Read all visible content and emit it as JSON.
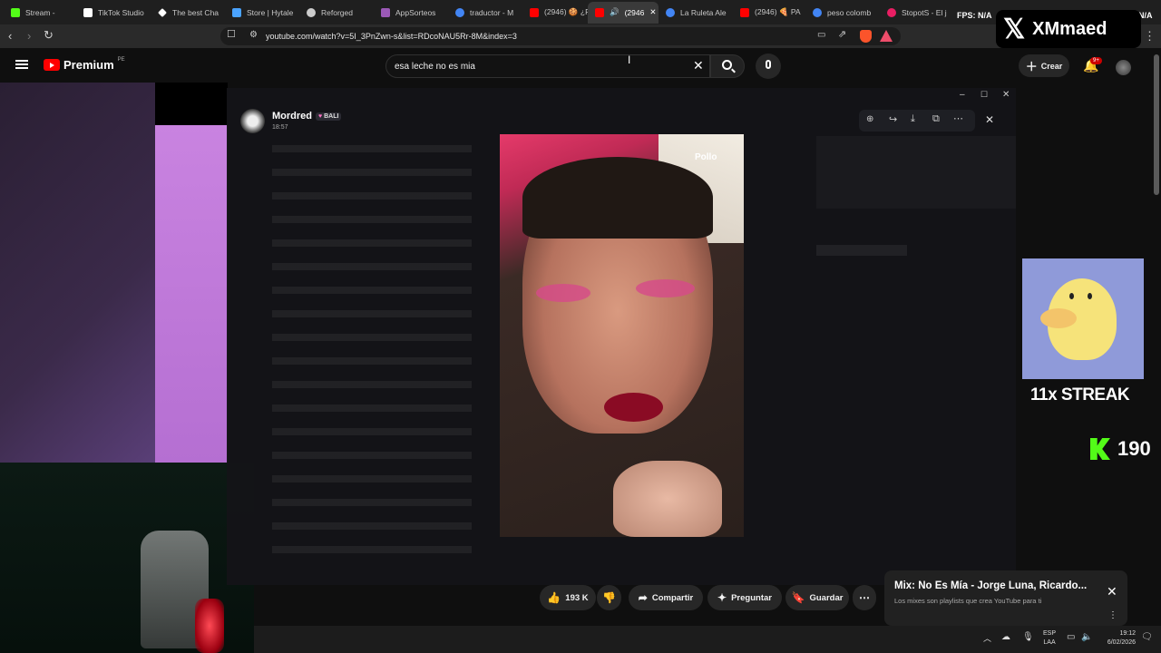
{
  "tabs": [
    {
      "label": "Stream -",
      "color": "#53fc18"
    },
    {
      "label": "TikTok Studio",
      "color": "#ffffff"
    },
    {
      "label": "The best Cha",
      "color": "#ffffff"
    },
    {
      "label": "Store | Hytale",
      "color": "#4aa3ff"
    },
    {
      "label": "Reforged",
      "color": "#cccccc"
    },
    {
      "label": "AppSorteos",
      "color": "#9b59b6"
    },
    {
      "label": "traductor - M",
      "color": "#4285f4"
    },
    {
      "label": "(2946) 🍪 ¿F",
      "color": "#ff0000"
    },
    {
      "label": "(2946",
      "color": "#ff0000"
    },
    {
      "label": "La Ruleta Ale",
      "color": "#4285f4"
    },
    {
      "label": "(2946) 🍕 PA",
      "color": "#ff0000"
    },
    {
      "label": "peso colomb",
      "color": "#4285f4"
    },
    {
      "label": "StopotS - El j",
      "color": "#e91e63"
    }
  ],
  "address": {
    "url": "youtube.com/watch?v=5I_3PnZwn-s&list=RDcoNAU5Rr-8M&index=3"
  },
  "youtube": {
    "logo": "Premium",
    "region": "PE",
    "search_value": "esa leche no es mia",
    "create_label": "Crear",
    "notif_count": "9+"
  },
  "viewer": {
    "username": "Mordred",
    "tag": "BALI",
    "time": "18:57",
    "photo_caption": "Pollo"
  },
  "overlay": {
    "x_text": "XMmaed",
    "streak": "11x STREAK",
    "kick_count": "190",
    "fps": "FPS: N/A",
    "fps_right": "N/A"
  },
  "actions": {
    "likes": "193 K",
    "share": "Compartir",
    "ask": "Preguntar",
    "save": "Guardar"
  },
  "mix": {
    "title": "Mix: No Es Mía - Jorge Luna, Ricardo...",
    "subtitle": "Los mixes son playlists que crea YouTube para ti"
  },
  "taskbar": {
    "lang1": "ESP",
    "lang2": "LAA",
    "time": "19:12",
    "date": "6/02/2026"
  }
}
